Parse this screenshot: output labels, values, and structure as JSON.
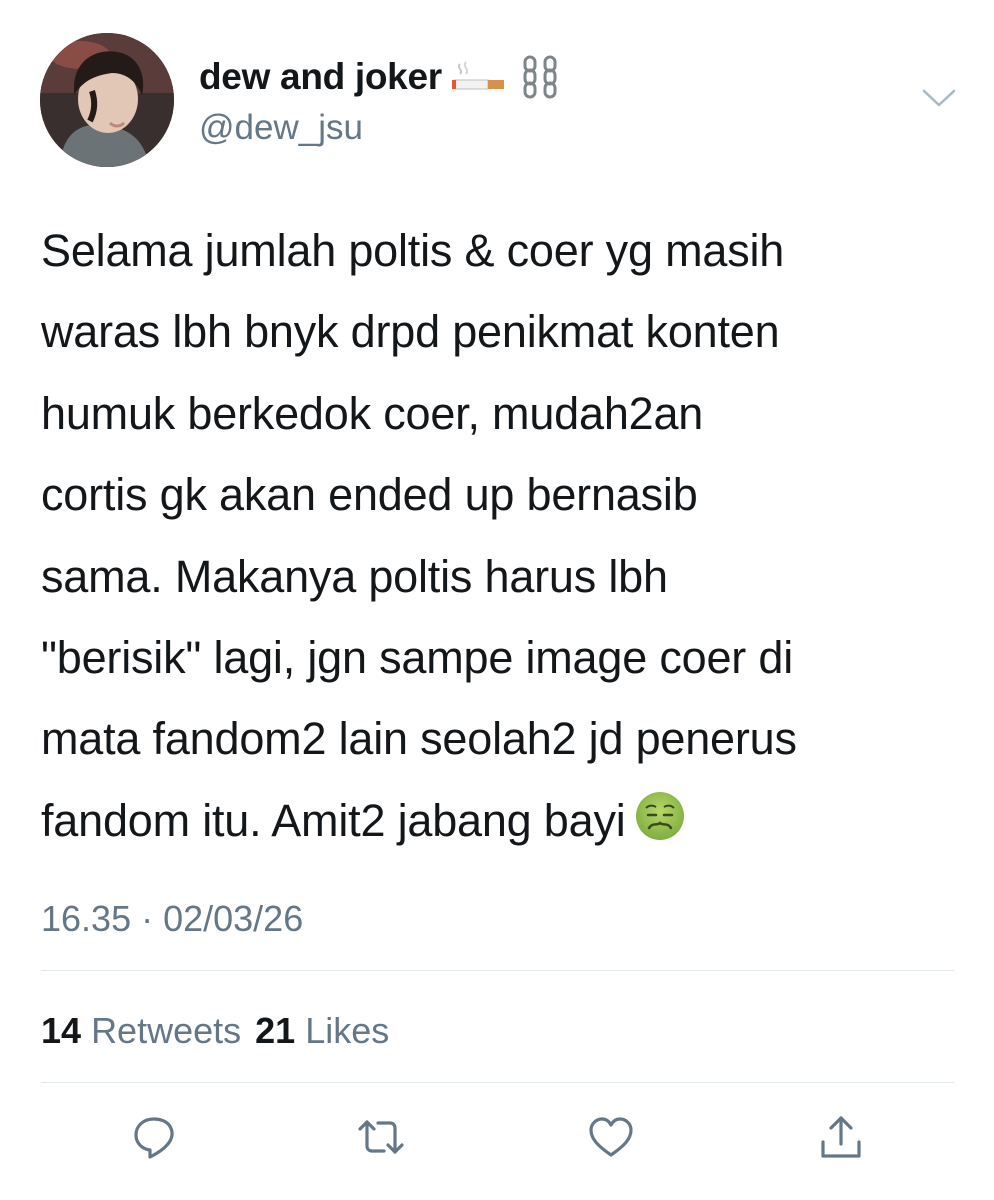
{
  "user": {
    "display_name": "dew and joker",
    "handle": "@dew_jsu",
    "name_emojis": [
      "cigarette-emoji",
      "chains-emoji"
    ]
  },
  "tweet": {
    "lines": [
      "Selama jumlah poltis & coer yg masih",
      "waras lbh bnyk drpd penikmat konten",
      "humuk berkedok coer, mudah2an",
      "cortis gk akan ended up bernasib",
      "sama. Makanya poltis harus lbh",
      "\"berisik\" lagi, jgn sampe image coer di",
      "mata fandom2 lain seolah2 jd penerus",
      "fandom itu. Amit2 jabang bayi"
    ],
    "trailing_emoji": "nauseated-face-emoji",
    "timestamp": "16.35 · 02/03/26"
  },
  "stats": {
    "retweets_count": "14",
    "retweets_label": "Retweets",
    "likes_count": "21",
    "likes_label": "Likes"
  },
  "actions": [
    "reply-icon",
    "retweet-icon",
    "like-icon",
    "share-icon"
  ],
  "colors": {
    "text": "#14171a",
    "secondary": "#657786",
    "divider": "#e1e8ed"
  }
}
